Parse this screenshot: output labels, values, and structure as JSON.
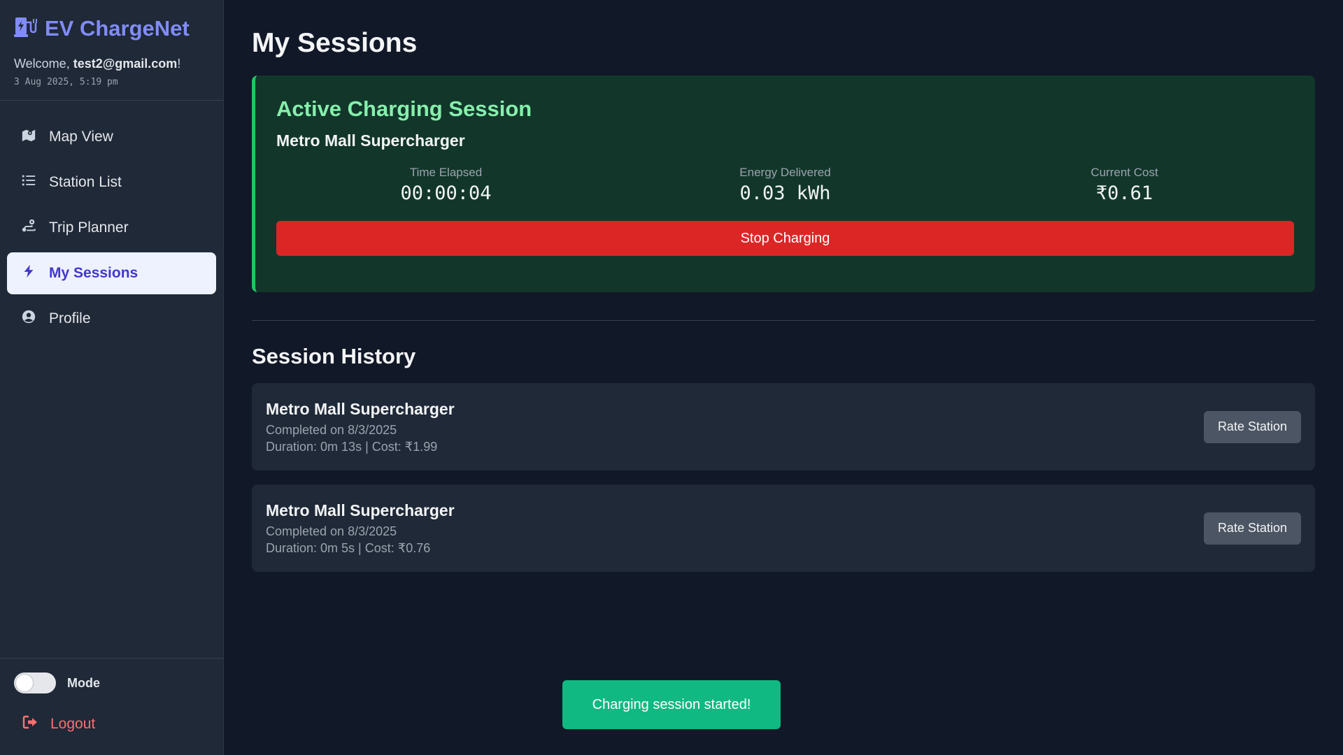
{
  "app": {
    "title": "EV ChargeNet",
    "welcome_prefix": "Welcome, ",
    "user_email": "test2@gmail.com",
    "welcome_suffix": "!",
    "datetime": "3 Aug 2025, 5:19 pm"
  },
  "sidebar": {
    "items": [
      {
        "label": "Map View",
        "icon": "map-icon",
        "active": false
      },
      {
        "label": "Station List",
        "icon": "list-icon",
        "active": false
      },
      {
        "label": "Trip Planner",
        "icon": "route-icon",
        "active": false
      },
      {
        "label": "My Sessions",
        "icon": "bolt-icon",
        "active": true
      },
      {
        "label": "Profile",
        "icon": "user-circle-icon",
        "active": false
      }
    ],
    "mode_label": "Mode",
    "logout_label": "Logout"
  },
  "main": {
    "page_title": "My Sessions",
    "active_session": {
      "heading": "Active Charging Session",
      "station": "Metro Mall Supercharger",
      "stats": [
        {
          "label": "Time Elapsed",
          "value": "00:00:04"
        },
        {
          "label": "Energy Delivered",
          "value": "0.03 kWh"
        },
        {
          "label": "Current Cost",
          "value": "₹0.61"
        }
      ],
      "stop_label": "Stop Charging"
    },
    "history": {
      "heading": "Session History",
      "sessions": [
        {
          "station": "Metro Mall Supercharger",
          "completed": "Completed on 8/3/2025",
          "details": "Duration: 0m 13s | Cost: ₹1.99",
          "rate_label": "Rate Station"
        },
        {
          "station": "Metro Mall Supercharger",
          "completed": "Completed on 8/3/2025",
          "details": "Duration: 0m 5s | Cost: ₹0.76",
          "rate_label": "Rate Station"
        }
      ]
    }
  },
  "toast": {
    "message": "Charging session started!"
  },
  "colors": {
    "accent": "#818cf8",
    "active_green": "#22c55e",
    "stop_red": "#dc2626",
    "toast_green": "#10b981",
    "logout_red": "#f87171"
  }
}
